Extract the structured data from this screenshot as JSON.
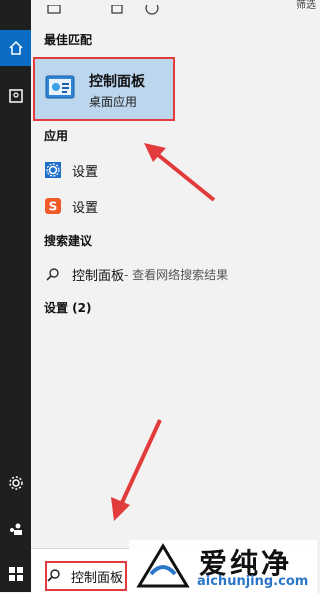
{
  "start_menu": {
    "sections": {
      "best_match": "最佳匹配",
      "apps": "应用",
      "search_suggestions": "搜索建议",
      "settings_count": "设置 (2)"
    },
    "best_match_item": {
      "title": "控制面板",
      "subtitle": "桌面应用"
    },
    "apps": [
      {
        "label": "设置",
        "icon": "gear-icon"
      },
      {
        "label": "设置",
        "icon": "sogou-icon"
      }
    ],
    "suggestion": {
      "label": "控制面板",
      "hint": " - 查看网络搜索结果"
    },
    "search": {
      "value": "控制面板"
    },
    "top_right_text": "筛选"
  },
  "watermark": {
    "brand": "爱纯净",
    "url": "aichunjing.com"
  },
  "colors": {
    "accent": "#0a6cc2",
    "highlight": "#bcd6ee",
    "annotation": "#e13b3b"
  }
}
